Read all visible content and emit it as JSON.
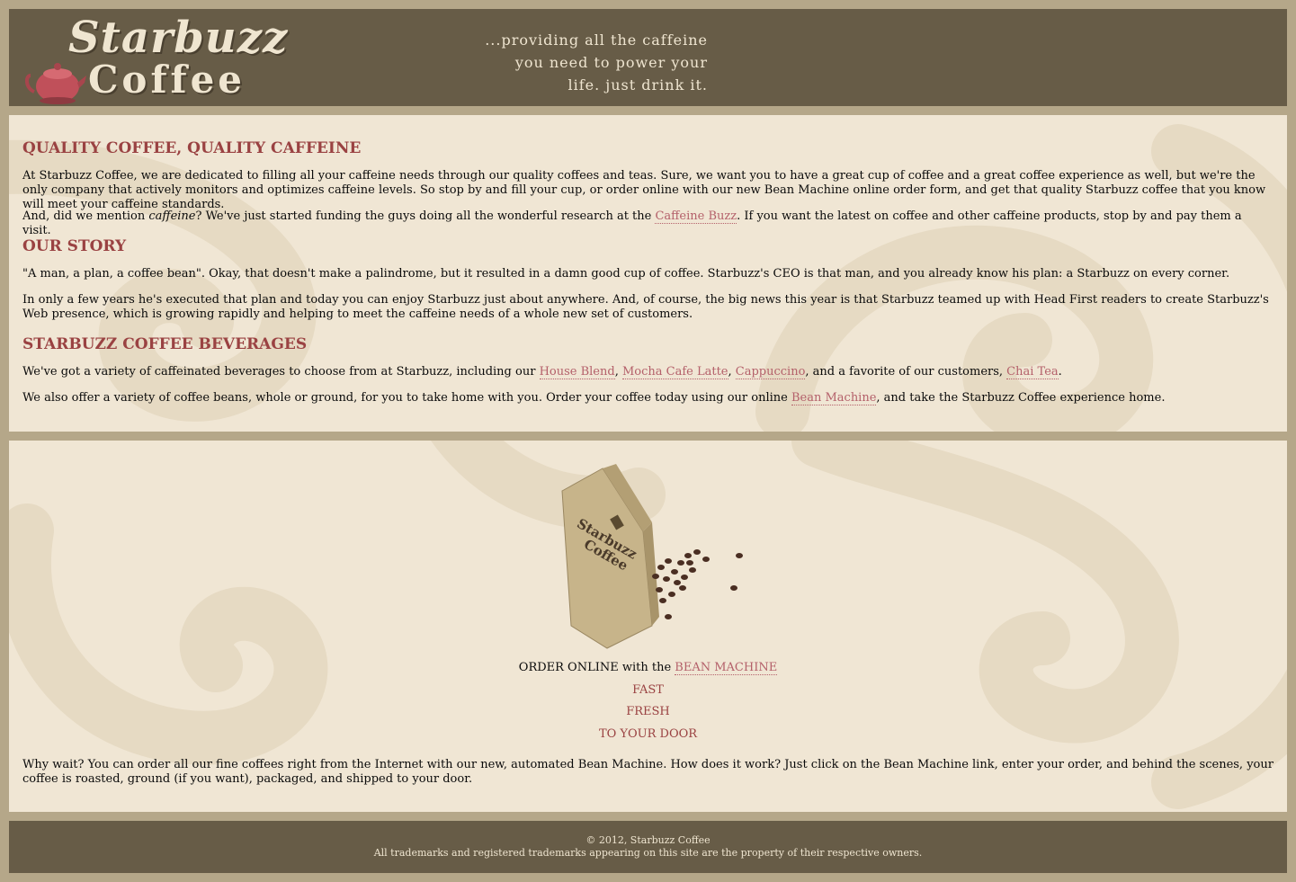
{
  "header": {
    "logo_line1": "Starbuzz",
    "logo_line2": "Coffee",
    "slogan": [
      "...providing all the caffeine",
      "you need to power your",
      "life. just drink it."
    ]
  },
  "main": {
    "section1": {
      "heading": "QUALITY COFFEE, QUALITY CAFFEINE",
      "p1": "At Starbuzz Coffee, we are dedicated to filling all your caffeine needs through our quality coffees and teas. Sure, we want you to have a great cup of coffee and a great coffee experience as well, but we're the only company that actively monitors and optimizes caffeine levels. So stop by and fill your cup, or order online with our new Bean Machine online order form, and get that quality Starbuzz coffee that you know will meet your caffeine standards.",
      "p2_before": "And, did we mention ",
      "p2_em": "caffeine",
      "p2_mid": "? We've just started funding the guys doing all the wonderful research at the ",
      "p2_link": "Caffeine Buzz",
      "p2_after": ". If you want the latest on coffee and other caffeine products, stop by and pay them a visit."
    },
    "section2": {
      "heading": "OUR STORY",
      "p1": "\"A man, a plan, a coffee bean\". Okay, that doesn't make a palindrome, but it resulted in a damn good cup of coffee. Starbuzz's CEO is that man, and you already know his plan: a Starbuzz on every corner.",
      "p2": "In only a few years he's executed that plan and today you can enjoy Starbuzz just about anywhere. And, of course, the big news this year is that Starbuzz teamed up with Head First readers to create Starbuzz's Web presence, which is growing rapidly and helping to meet the caffeine needs of a whole new set of customers."
    },
    "section3": {
      "heading": "STARBUZZ COFFEE BEVERAGES",
      "p1_before": "We've got a variety of caffeinated beverages to choose from at Starbuzz, including our ",
      "link_house": "House Blend",
      "link_mocha": "Mocha Cafe Latte",
      "link_capp": "Cappuccino",
      "p1_mid": ", and a favorite of our customers, ",
      "link_chai": "Chai Tea",
      "p2_before": "We also offer a variety of coffee beans, whole or ground, for you to take home with you. Order your coffee today using our online ",
      "link_bean": "Bean Machine",
      "p2_after": ", and take the Starbuzz Coffee experience home."
    }
  },
  "sidebar": {
    "bag_line1": "Starbuzz",
    "bag_line2": "Coffee",
    "order_prefix": "ORDER ONLINE with the ",
    "order_link": "BEAN MACHINE",
    "fast": "FAST",
    "fresh": "FRESH",
    "door": "TO YOUR DOOR",
    "paragraph": "Why wait? You can order all our fine coffees right from the Internet with our new, automated Bean Machine. How does it work? Just click on the Bean Machine link, enter your order, and behind the scenes, your coffee is roasted, ground (if you want), packaged, and shipped to your door."
  },
  "footer": {
    "copyright": "© 2012, Starbuzz Coffee",
    "trademarks": "All trademarks and registered trademarks appearing on this site are the property of their respective owners."
  }
}
